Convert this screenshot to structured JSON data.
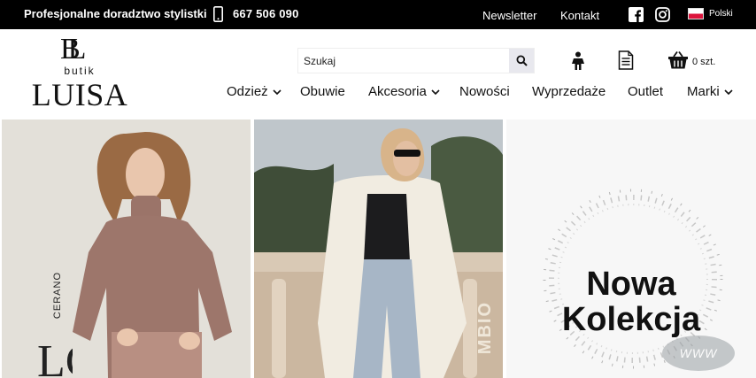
{
  "topbar": {
    "advice": "Profesjonalne doradztwo stylistki",
    "phone": "667 506 090",
    "newsletter": "Newsletter",
    "contact": "Kontakt",
    "language": "Polski",
    "icons": [
      "phone-icon",
      "facebook-icon",
      "instagram-icon",
      "poland-flag-icon"
    ]
  },
  "logo": {
    "monogram": "BL",
    "sub": "butik",
    "name": "LUISA"
  },
  "search": {
    "placeholder": "Szukaj",
    "icon": "search-icon"
  },
  "header_icons": [
    "account-icon",
    "wishlist-list-icon",
    "cart-icon"
  ],
  "cart": {
    "count_label": "0 szt."
  },
  "nav": {
    "items": [
      {
        "label": "Odzież",
        "has_dropdown": true
      },
      {
        "label": "Obuwie",
        "has_dropdown": false
      },
      {
        "label": "Akcesoria",
        "has_dropdown": true
      },
      {
        "label": "Nowości",
        "has_dropdown": false
      },
      {
        "label": "Wyprzedaże",
        "has_dropdown": false
      },
      {
        "label": "Outlet",
        "has_dropdown": false
      },
      {
        "label": "Marki",
        "has_dropdown": true
      }
    ]
  },
  "banners": [
    {
      "brand": "CERANO"
    },
    {
      "brand": "MBIO"
    },
    {
      "title_line1": "Nowa",
      "title_line2": "Kolekcja",
      "watermark": "WWW"
    }
  ],
  "colors": {
    "topbar_bg": "#000000",
    "search_button_bg": "#e8e8ee",
    "flag_white": "#ffffff",
    "flag_red": "#dc143c"
  }
}
